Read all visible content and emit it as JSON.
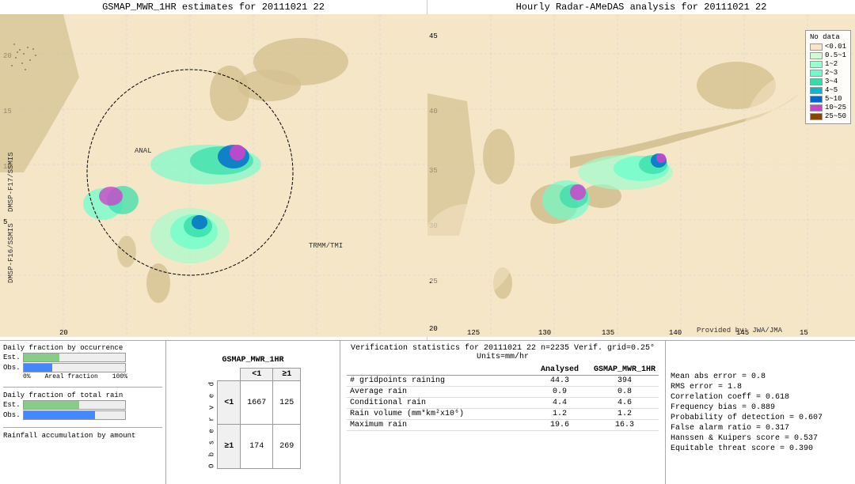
{
  "leftMap": {
    "title": "GSMAP_MWR_1HR estimates for 20111021 22",
    "axisLabel": "DMSP-F17/SSMIS",
    "sublabel": "DMSP-F16/SSMIS",
    "trmmLabel": "TRMM/TMI",
    "analLabel": "ANAL"
  },
  "rightMap": {
    "title": "Hourly Radar-AMeDAS analysis for 20111021 22",
    "credit": "Provided by: JWA/JMA"
  },
  "legend": {
    "title": "No data",
    "items": [
      {
        "label": "No data",
        "color": "#f5e6c8"
      },
      {
        "label": "<0.01",
        "color": "#ffffcc"
      },
      {
        "label": "0.5~1",
        "color": "#ccffcc"
      },
      {
        "label": "1~2",
        "color": "#99ffcc"
      },
      {
        "label": "2~3",
        "color": "#66ffcc"
      },
      {
        "label": "3~4",
        "color": "#33ddaa"
      },
      {
        "label": "4~5",
        "color": "#00bbcc"
      },
      {
        "label": "5~10",
        "color": "#0066cc"
      },
      {
        "label": "10~25",
        "color": "#cc44cc"
      },
      {
        "label": "25~50",
        "color": "#884400"
      }
    ]
  },
  "barCharts": {
    "title1": "Daily fraction by occurrence",
    "title2": "Daily fraction of total rain",
    "title3": "Rainfall accumulation by amount",
    "estLabel": "Est.",
    "obsLabel": "Obs.",
    "axis0": "0%",
    "axis100": "100%",
    "axisAreaFraction": "Areal fraction"
  },
  "contingency": {
    "title": "GSMAP_MWR_1HR",
    "colHeader1": "<1",
    "colHeader2": "≥1",
    "rowHeader1": "<1",
    "rowHeader2": "≥1",
    "obsLabel": "O\nb\ns\ne\nr\nv\ne\nd",
    "val11": "1667",
    "val12": "125",
    "val21": "174",
    "val22": "269"
  },
  "verifStats": {
    "title": "Verification statistics for 20111021 22  n=2235  Verif. grid=0.25°  Units=mm/hr",
    "headers": [
      "",
      "Analysed",
      "GSMAP_MWR_1HR"
    ],
    "rows": [
      {
        "metric": "# gridpoints raining",
        "analysed": "44.3",
        "gsmap": "394"
      },
      {
        "metric": "Average rain",
        "analysed": "0.9",
        "gsmap": "0.8"
      },
      {
        "metric": "Conditional rain",
        "analysed": "4.4",
        "gsmap": "4.6"
      },
      {
        "metric": "Rain volume (mm*km²x10⁶)",
        "analysed": "1.2",
        "gsmap": "1.2"
      },
      {
        "metric": "Maximum rain",
        "analysed": "19.6",
        "gsmap": "16.3"
      }
    ]
  },
  "rightStats": {
    "meanAbsError": "Mean abs error = 0.8",
    "rmsError": "RMS error = 1.8",
    "correlCoeff": "Correlation coeff = 0.618",
    "freqBias": "Frequency bias = 0.889",
    "probDetection": "Probability of detection = 0.607",
    "falseAlarmRatio": "False alarm ratio = 0.317",
    "hanssenKuipers": "Hanssen & Kuipers score = 0.537",
    "equitableThreat": "Equitable threat score = 0.390"
  }
}
